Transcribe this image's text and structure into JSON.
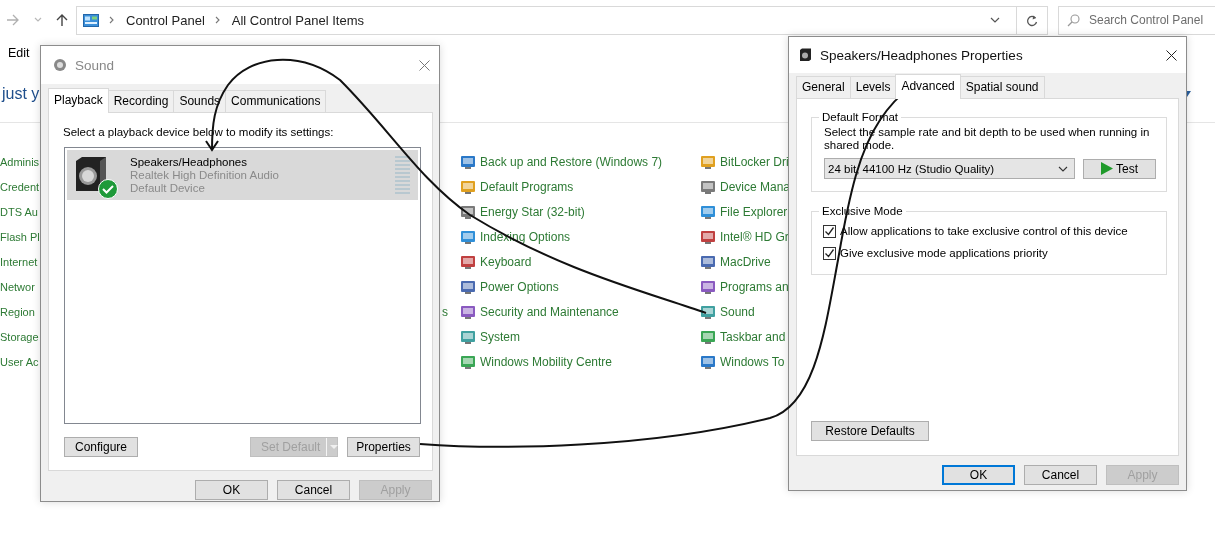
{
  "explorer": {
    "breadcrumb": [
      "Control Panel",
      "All Control Panel Items"
    ],
    "search": {
      "placeholder": "Search Control Panel"
    },
    "menu": [
      "Edit"
    ],
    "heading": "just y",
    "columns": [
      {
        "icons": false,
        "items": [
          {
            "label": "Adminis"
          },
          {
            "label": "Credent"
          },
          {
            "label": "DTS Au"
          },
          {
            "label": "Flash Pl"
          },
          {
            "label": "Internet"
          },
          {
            "label": "Networ"
          },
          {
            "label": "Region",
            "tail": "s"
          },
          {
            "label": "Storage"
          },
          {
            "label": "User Ac"
          }
        ]
      },
      {
        "icons": true,
        "items": [
          {
            "label": "Back up and Restore (Windows 7)"
          },
          {
            "label": "Default Programs"
          },
          {
            "label": "Energy Star (32-bit)"
          },
          {
            "label": "Indexing Options"
          },
          {
            "label": "Keyboard"
          },
          {
            "label": "Power Options"
          },
          {
            "label": "Security and Maintenance"
          },
          {
            "label": "System"
          },
          {
            "label": "Windows Mobility Centre"
          }
        ]
      },
      {
        "icons": true,
        "items": [
          {
            "label": "BitLocker Dri"
          },
          {
            "label": "Device Mana"
          },
          {
            "label": "File Explorer"
          },
          {
            "label": "Intel® HD Gr"
          },
          {
            "label": "MacDrive"
          },
          {
            "label": "Programs an"
          },
          {
            "label": "Sound"
          },
          {
            "label": "Taskbar and"
          },
          {
            "label": "Windows To"
          }
        ]
      }
    ]
  },
  "sound_dialog": {
    "title": "Sound",
    "active": false,
    "tabs": [
      {
        "label": "Playback",
        "selected": true
      },
      {
        "label": "Recording",
        "selected": false
      },
      {
        "label": "Sounds",
        "selected": false
      },
      {
        "label": "Communications",
        "selected": false
      }
    ],
    "instruction": "Select a playback device below to modify its settings:",
    "devices": [
      {
        "name": "Speakers/Headphones",
        "driver": "Realtek High Definition Audio",
        "status": "Default Device",
        "selected": true,
        "default_device": true
      }
    ],
    "buttons": [
      {
        "label": "Configure",
        "kind": "plain",
        "disabled": false
      },
      {
        "label": "Set Default",
        "kind": "split",
        "disabled": true
      },
      {
        "label": "Properties",
        "kind": "plain",
        "disabled": false
      }
    ],
    "dialog_buttons": [
      {
        "label": "OK",
        "disabled": false,
        "default": false
      },
      {
        "label": "Cancel",
        "disabled": false,
        "default": false
      },
      {
        "label": "Apply",
        "disabled": true,
        "default": false
      }
    ]
  },
  "properties_dialog": {
    "title": "Speakers/Headphones Properties",
    "active": true,
    "tabs": [
      {
        "label": "General",
        "selected": false
      },
      {
        "label": "Levels",
        "selected": false
      },
      {
        "label": "Advanced",
        "selected": true
      },
      {
        "label": "Spatial sound",
        "selected": false
      }
    ],
    "default_format": {
      "title": "Default Format",
      "description": "Select the sample rate and bit depth to be used when running in shared mode.",
      "value": "24 bit, 44100 Hz (Studio Quality)",
      "test_button": "Test"
    },
    "exclusive_mode": {
      "title": "Exclusive Mode",
      "options": [
        {
          "label": "Allow applications to take exclusive control of this device",
          "checked": true
        },
        {
          "label": "Give exclusive mode applications priority",
          "checked": true
        }
      ]
    },
    "restore_button": "Restore Defaults",
    "dialog_buttons": [
      {
        "label": "OK",
        "disabled": false,
        "default": true
      },
      {
        "label": "Cancel",
        "disabled": false,
        "default": false
      },
      {
        "label": "Apply",
        "disabled": true,
        "default": false
      }
    ]
  }
}
